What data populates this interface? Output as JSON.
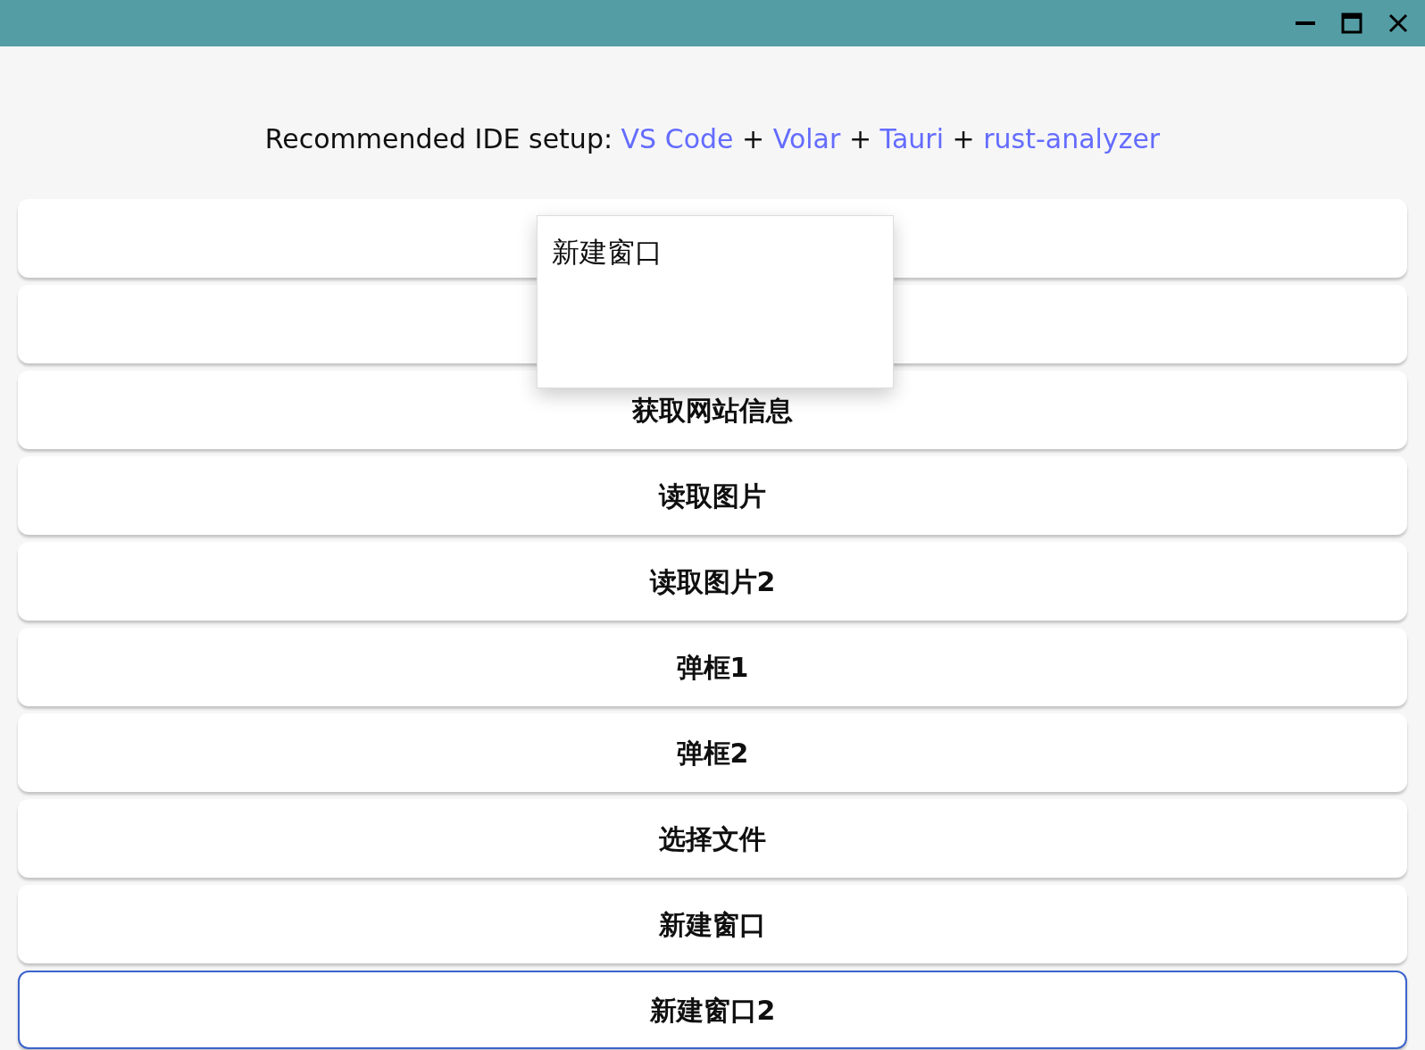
{
  "setup": {
    "prefix": "Recommended IDE setup:",
    "parts": [
      {
        "kind": "link",
        "text": "VS Code"
      },
      {
        "kind": "text",
        "text": "+"
      },
      {
        "kind": "link",
        "text": "Volar"
      },
      {
        "kind": "text",
        "text": "+"
      },
      {
        "kind": "link",
        "text": "Tauri"
      },
      {
        "kind": "text",
        "text": "+"
      },
      {
        "kind": "link",
        "text": "rust-analyzer"
      }
    ]
  },
  "buttons": [
    {
      "focused": false
    },
    {
      "focused": false
    },
    {
      "label": "获取网站信息",
      "focused": false
    },
    {
      "label": "读取图片",
      "focused": false
    },
    {
      "label": "读取图片2",
      "focused": false
    },
    {
      "label": "弹框1",
      "focused": false
    },
    {
      "label": "弹框2",
      "focused": false
    },
    {
      "label": "选择文件",
      "focused": false
    },
    {
      "label": "新建窗口",
      "focused": false
    },
    {
      "label": "新建窗口2",
      "focused": true
    }
  ],
  "popup": {
    "title": "新建窗口"
  }
}
